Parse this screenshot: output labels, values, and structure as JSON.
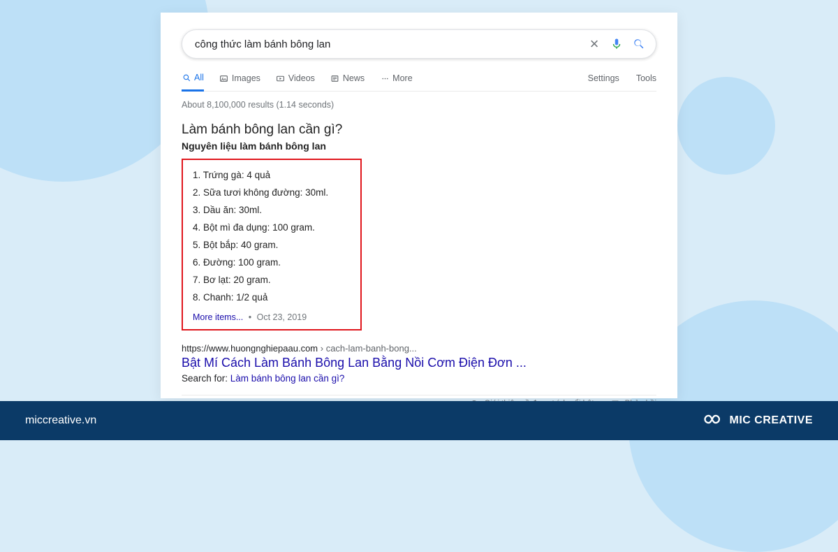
{
  "search": {
    "query": "công thức làm bánh bông lan"
  },
  "tabs": {
    "all": "All",
    "images": "Images",
    "videos": "Videos",
    "news": "News",
    "more": "More",
    "settings": "Settings",
    "tools": "Tools"
  },
  "stats": "About 8,100,000 results (1.14 seconds)",
  "snippet": {
    "title": "Làm bánh bông lan cần gì?",
    "subtitle": "Nguyên liệu làm bánh bông lan",
    "items": [
      "Trứng gà: 4 quả",
      "Sữa tươi không đường: 30ml.",
      "Dầu ăn: 30ml.",
      "Bột mì đa dụng: 100 gram.",
      "Bột bắp: 40 gram.",
      "Đường: 100 gram.",
      "Bơ lạt: 20 gram.",
      "Chanh: 1/2 quả"
    ],
    "more_label": "More items...",
    "date": "Oct 23, 2019"
  },
  "result": {
    "url_host": "https://www.huongnghiepaau.com",
    "url_path": " › cach-lam-banh-bong...",
    "title": "Bật Mí Cách Làm Bánh Bông Lan Bằng Nồi Cơm Điện Đơn ...",
    "search_for_prefix": "Search for: ",
    "search_for_link": "Làm bánh bông lan cần gì?"
  },
  "feedback": {
    "about": "Giới thiệu về đoạn trích nổi bật",
    "report": "Phản hồi"
  },
  "footer": {
    "domain": "miccreative.vn",
    "brand": "MIC CREATIVE"
  }
}
